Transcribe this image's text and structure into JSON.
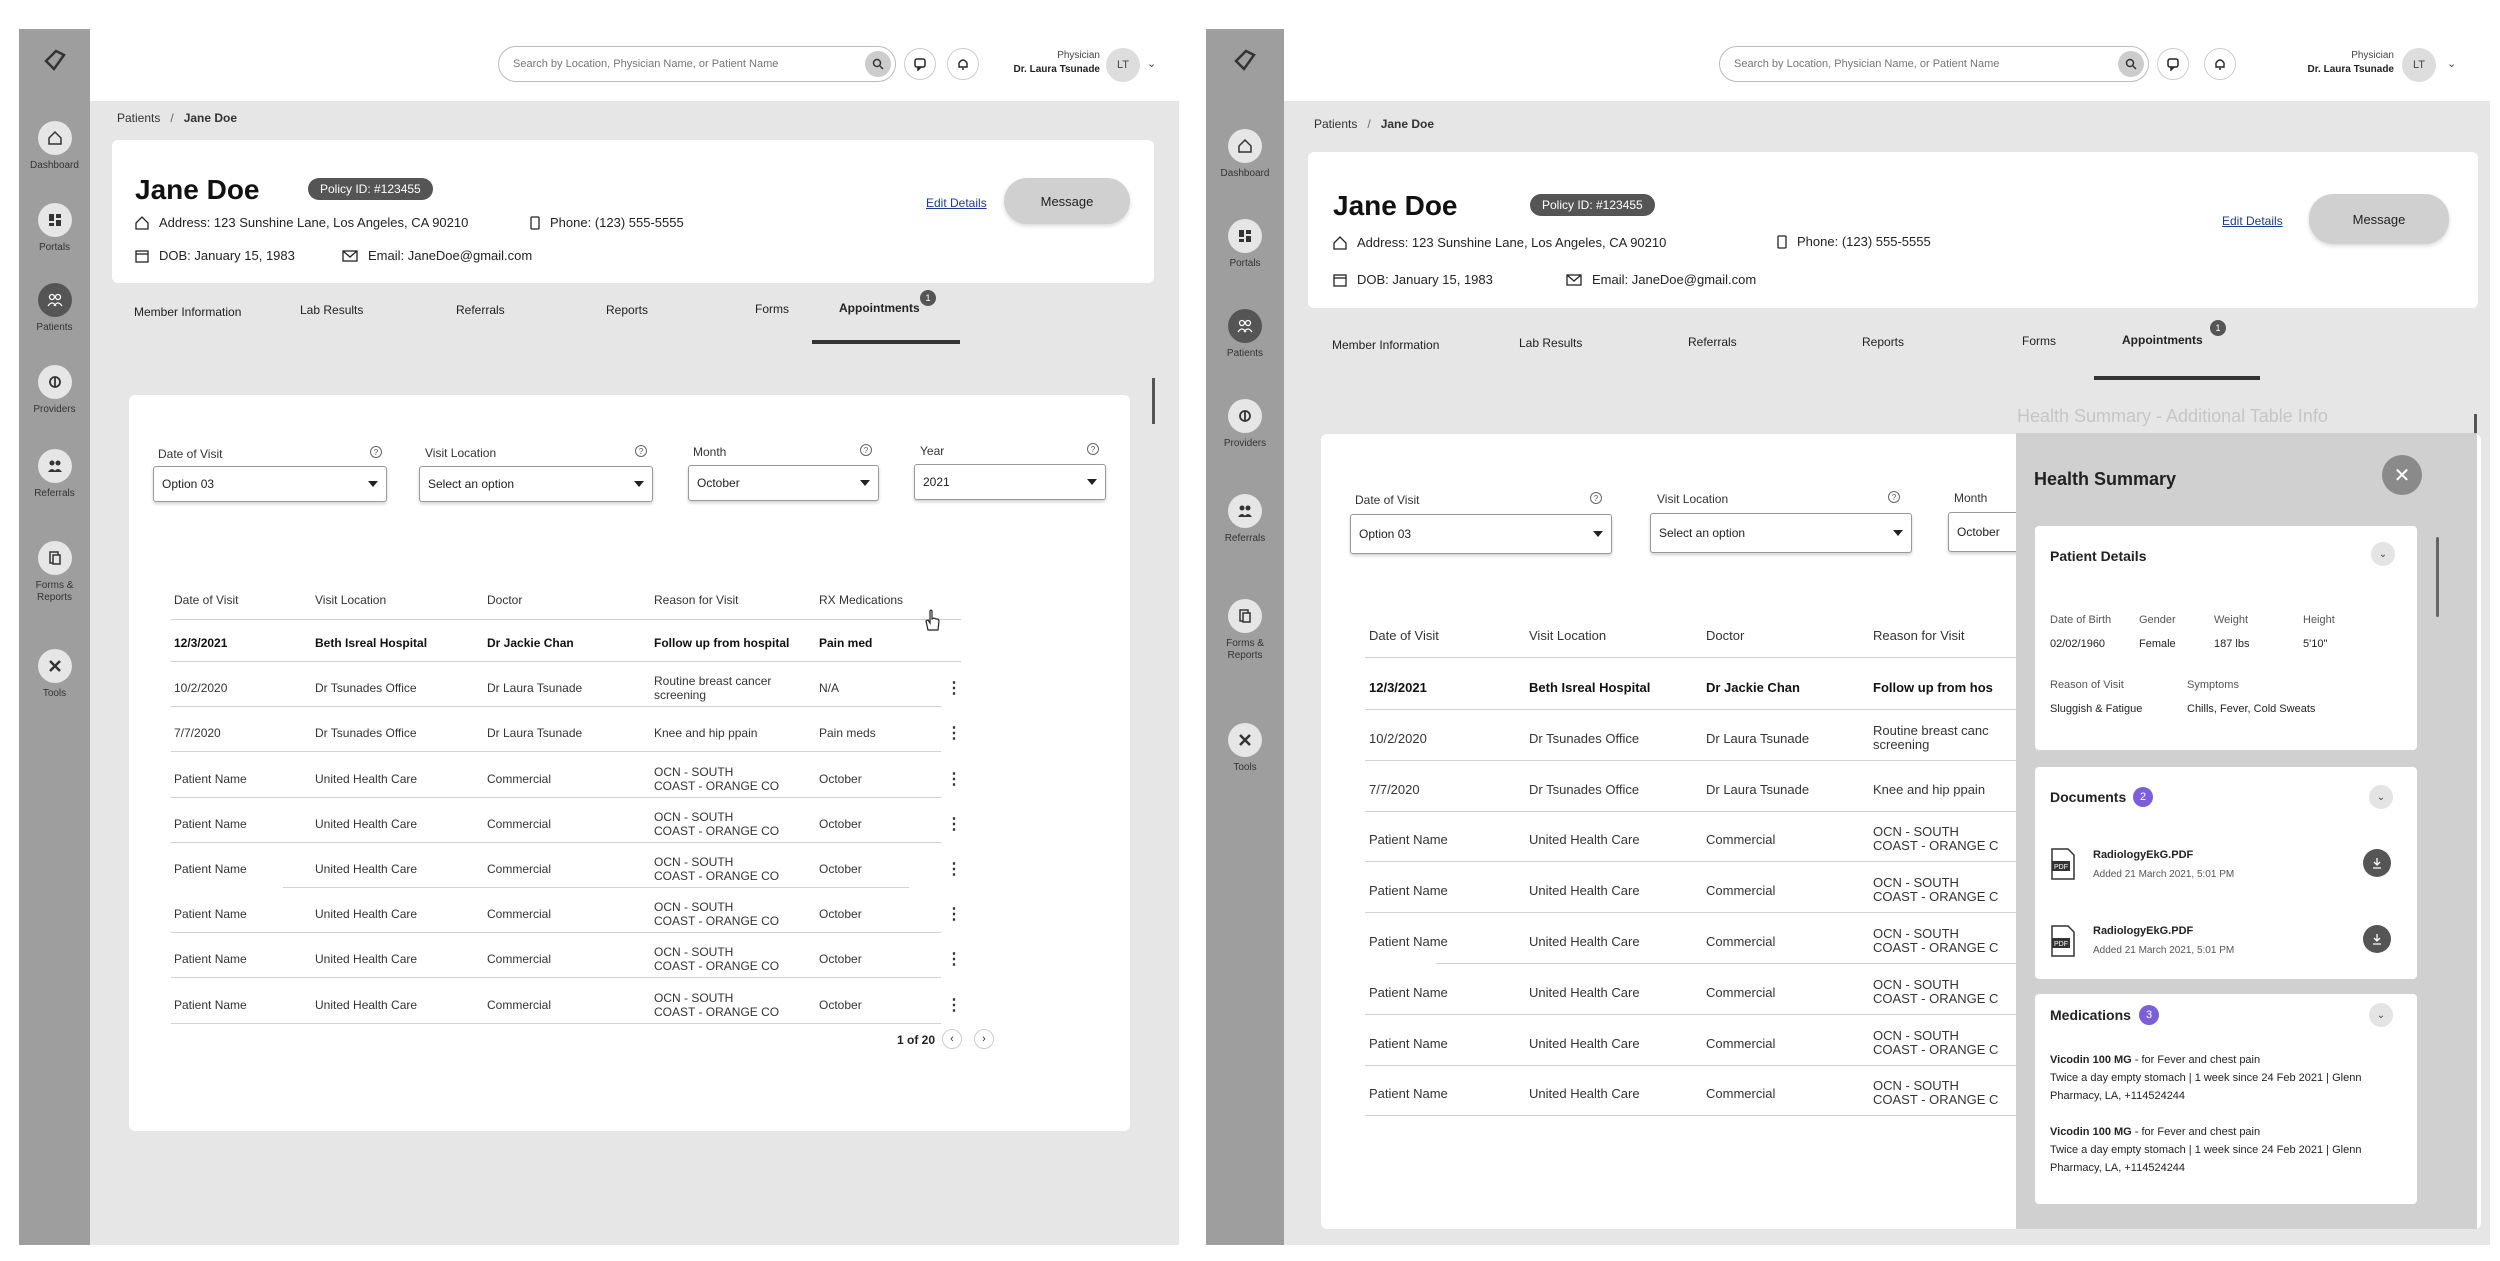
{
  "nav": [
    {
      "label": "Dashboard",
      "icon": "home-icon"
    },
    {
      "label": "Portals",
      "icon": "portal-icon"
    },
    {
      "label": "Patients",
      "icon": "patients-icon"
    },
    {
      "label": "Providers",
      "icon": "providers-icon"
    },
    {
      "label": "Referrals",
      "icon": "referrals-icon"
    },
    {
      "label": "Forms & Reports",
      "icon": "forms-icon"
    },
    {
      "label": "Tools",
      "icon": "tools-icon"
    }
  ],
  "topbar": {
    "search_placeholder": "Search by Location, Physician Name, or Patient Name",
    "role": "Physician",
    "user_name": "Dr. Laura Tsunade",
    "initials": "LT"
  },
  "breadcrumb": {
    "root": "Patients",
    "sep": "/",
    "current": "Jane Doe"
  },
  "patient": {
    "name": "Jane Doe",
    "policy": "Policy ID: #123455",
    "address": "Address: 123 Sunshine Lane, Los Angeles, CA 90210",
    "phone": "Phone: (123) 555-5555",
    "dob": "DOB: January 15, 1983",
    "email": "Email: JaneDoe@gmail.com",
    "edit": "Edit Details",
    "message": "Message"
  },
  "tabs": [
    "Member Information",
    "Lab Results",
    "Referrals",
    "Reports",
    "Forms",
    "Appointments"
  ],
  "tab_badge": "1",
  "filters": [
    {
      "label": "Date of Visit",
      "value": "Option 03"
    },
    {
      "label": "Visit Location",
      "value": "Select an option"
    },
    {
      "label": "Month",
      "value": "October"
    },
    {
      "label": "Year",
      "value": "2021"
    }
  ],
  "table": {
    "columns": [
      "Date of Visit",
      "Visit Location",
      "Doctor",
      "Reason for Visit",
      "RX Medications"
    ],
    "rows": [
      [
        "12/3/2021",
        "Beth Isreal Hospital",
        "Dr Jackie Chan",
        "Follow up from hospital",
        "Pain med"
      ],
      [
        "10/2/2020",
        "Dr Tsunades Office",
        "Dr Laura Tsunade",
        "Routine breast cancer screening",
        "N/A"
      ],
      [
        "7/7/2020",
        "Dr Tsunades Office",
        "Dr Laura Tsunade",
        "Knee and hip ppain",
        "Pain meds"
      ],
      [
        "Patient Name",
        "United Health Care",
        "Commercial",
        "OCN - SOUTH COAST - ORANGE CO",
        "October"
      ],
      [
        "Patient Name",
        "United Health Care",
        "Commercial",
        "OCN - SOUTH COAST - ORANGE CO",
        "October"
      ],
      [
        "Patient Name",
        "United Health Care",
        "Commercial",
        "OCN - SOUTH COAST - ORANGE CO",
        "October"
      ],
      [
        "Patient Name",
        "United Health Care",
        "Commercial",
        "OCN - SOUTH COAST - ORANGE CO",
        "October"
      ],
      [
        "Patient Name",
        "United Health Care",
        "Commercial",
        "OCN - SOUTH COAST - ORANGE CO",
        "October"
      ],
      [
        "Patient Name",
        "United Health Care",
        "Commercial",
        "OCN - SOUTH COAST - ORANGE CO",
        "October"
      ]
    ],
    "truncated_b": {
      "reason0": "Follow up from hos",
      "reason1a": "Routine breast canc",
      "reason1b": "screening",
      "reason2": "Knee and hip ppain",
      "ocn_a": "OCN - SOUTH",
      "ocn_b": "COAST - ORANGE C"
    },
    "ocn_line1": "OCN - SOUTH",
    "ocn_line2": "COAST - ORANGE CO",
    "reason1_line1": "Routine breast cancer",
    "reason1_line2": "screening",
    "pager": "1 of 20"
  },
  "health_summary": {
    "bg_title": "Health Summary - Additional Table Info",
    "title": "Health Summary",
    "patient_details": {
      "title": "Patient Details",
      "fields": [
        {
          "k": "Date of Birth",
          "v": "02/02/1960"
        },
        {
          "k": "Gender",
          "v": "Female"
        },
        {
          "k": "Weight",
          "v": "187 lbs"
        },
        {
          "k": "Height",
          "v": "5'10\""
        }
      ],
      "reason_k": "Reason of Visit",
      "reason_v": "Sluggish & Fatigue",
      "symptoms_k": "Symptoms",
      "symptoms_v": "Chills, Fever, Cold Sweats"
    },
    "documents": {
      "title": "Documents",
      "count": "2",
      "items": [
        {
          "name": "RadiologyEkG.PDF",
          "date": "Added 21 March 2021, 5:01 PM"
        },
        {
          "name": "RadiologyEkG.PDF",
          "date": "Added 21 March 2021, 5:01 PM"
        }
      ]
    },
    "medications": {
      "title": "Medications",
      "count": "3",
      "items": [
        {
          "name": "Vicodin 100 MG",
          "for": " - for Fever and chest pain",
          "l1": "Twice a day empty stomach  |  1 week since 24 Feb 2021  |  Glenn",
          "l2": "Pharmacy, LA, +114524244"
        },
        {
          "name": "Vicodin 100 MG",
          "for": " - for Fever and chest pain",
          "l1": "Twice a day empty stomach  |  1 week since 24 Feb 2021  |  Glenn",
          "l2": "Pharmacy, LA, +114524244"
        }
      ]
    }
  },
  "colors": {
    "sidebar": "#9e9e9e",
    "active_nav": "#555555",
    "count_badge": "#7c5fd6",
    "link": "#1e3a8a"
  }
}
